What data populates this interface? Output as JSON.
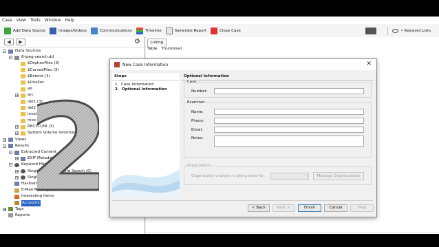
{
  "menu": [
    "Case",
    "View",
    "Tools",
    "Window",
    "Help"
  ],
  "toolbar": {
    "items": [
      {
        "label": "Add Data Source",
        "icon": "add-icon"
      },
      {
        "label": "Images/Videos",
        "icon": "images-icon"
      },
      {
        "label": "Communications",
        "icon": "communications-icon"
      },
      {
        "label": "Timeline",
        "icon": "timeline-icon"
      },
      {
        "label": "Generate Report",
        "icon": "report-icon"
      },
      {
        "label": "Close Case",
        "icon": "close-case-icon"
      }
    ],
    "keyword_lists": "• Keyword Lists"
  },
  "tree": [
    {
      "label": "Data Sources",
      "depth": 0,
      "exp": "-",
      "icon": "grp"
    },
    {
      "label": "8-jpeg-search.dd",
      "depth": 1,
      "exp": "-",
      "icon": "dsk"
    },
    {
      "label": "$OrphanFiles (0)",
      "depth": 2,
      "exp": "",
      "icon": "fold"
    },
    {
      "label": "$CarvedFiles (3)",
      "depth": 2,
      "exp": "",
      "icon": "fold"
    },
    {
      "label": "$Extend (3)",
      "depth": 2,
      "exp": "",
      "icon": "fold"
    },
    {
      "label": "$Unalloc",
      "depth": 2,
      "exp": "",
      "icon": "fold"
    },
    {
      "label": "ali",
      "depth": 2,
      "exp": "",
      "icon": "fold"
    },
    {
      "label": "arc",
      "depth": 2,
      "exp": "+",
      "icon": "fold"
    },
    {
      "label": "del1 (3)",
      "depth": 2,
      "exp": "",
      "icon": "fold"
    },
    {
      "label": "del2 (3)",
      "depth": 2,
      "exp": "",
      "icon": "fold"
    },
    {
      "label": "invalid (5)",
      "depth": 2,
      "exp": "",
      "icon": "fold"
    },
    {
      "label": "misc (6)",
      "depth": 2,
      "exp": "",
      "icon": "fold"
    },
    {
      "label": "RECYCLER (3)",
      "depth": 2,
      "exp": "+",
      "icon": "fold"
    },
    {
      "label": "System Volume Information (3)",
      "depth": 2,
      "exp": "+",
      "icon": "fold"
    },
    {
      "label": "Views",
      "depth": 0,
      "exp": "+",
      "icon": "grp"
    },
    {
      "label": "Results",
      "depth": 0,
      "exp": "-",
      "icon": "grp"
    },
    {
      "label": "Extracted Content",
      "depth": 1,
      "exp": "-",
      "icon": "grp"
    },
    {
      "label": "EXIF Metadata",
      "depth": 2,
      "exp": "+",
      "icon": "grp"
    },
    {
      "label": "Keyword Hits",
      "depth": 1,
      "exp": "-",
      "icon": "kw"
    },
    {
      "label": "Single Literal Keyword Search (0)",
      "depth": 2,
      "exp": "+",
      "icon": "kw"
    },
    {
      "label": "Single Regular Expression Search (0)",
      "depth": 2,
      "exp": "+",
      "icon": "kw"
    },
    {
      "label": "Hashset Hits",
      "depth": 1,
      "exp": "",
      "icon": "grp"
    },
    {
      "label": "E-Mail Messages",
      "depth": 1,
      "exp": "",
      "icon": "mail"
    },
    {
      "label": "Interesting Items",
      "depth": 1,
      "exp": "",
      "icon": "star"
    },
    {
      "label": "Accounts",
      "depth": 1,
      "exp": "",
      "icon": "acct",
      "selected": true
    },
    {
      "label": "Tags",
      "depth": 0,
      "exp": "+",
      "icon": "tag"
    },
    {
      "label": "Reports",
      "depth": 0,
      "exp": "",
      "icon": "rep"
    }
  ],
  "overlay_digit": "2",
  "right": {
    "tab": "Listing",
    "subtabs": [
      "Table",
      "Thumbnail"
    ]
  },
  "dialog": {
    "title": "New Case Information",
    "steps_header": "Steps",
    "steps": [
      {
        "num": "1.",
        "label": "Case Information"
      },
      {
        "num": "2.",
        "label": "Optional Information"
      }
    ],
    "panel_header": "Optional Information",
    "case_group": "Case",
    "number_label": "Number:",
    "number_value": "",
    "examiner_group": "Examiner",
    "name_label": "Name:",
    "phone_label": "Phone:",
    "email_label": "Email:",
    "notes_label": "Notes:",
    "org_group": "Organization",
    "org_question": "Organization analysis is being done for:",
    "manage_orgs": "Manage Organizations",
    "buttons": {
      "back": "< Back",
      "next": "Next >",
      "finish": "Finish",
      "cancel": "Cancel",
      "help": "Help"
    }
  },
  "colors": {
    "selection": "#2a64c5",
    "titlebar_icon": "#b2452f",
    "dialog_bg": "#f0f0f0"
  }
}
